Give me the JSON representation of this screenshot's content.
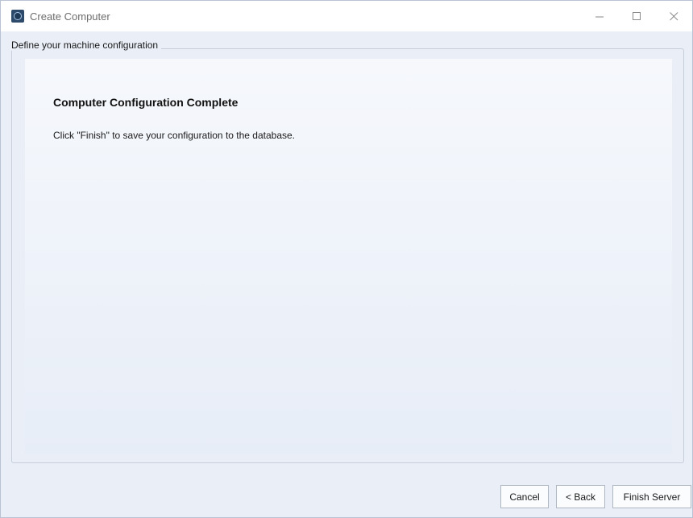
{
  "window": {
    "title": "Create Computer"
  },
  "groupbox": {
    "legend": "Define your machine configuration"
  },
  "content": {
    "heading": "Computer Configuration Complete",
    "description": "Click \"Finish\" to save your configuration to the database."
  },
  "buttons": {
    "cancel_label": "Cancel",
    "back_label": "< Back",
    "finish_label": "Finish Server"
  },
  "icons": {
    "app": "app-icon",
    "minimize": "minimize-icon",
    "maximize": "maximize-icon",
    "close": "close-icon"
  },
  "colors": {
    "background": "#e9eef7",
    "titlebar": "#ffffff",
    "button_border": "#aeb6c2"
  }
}
